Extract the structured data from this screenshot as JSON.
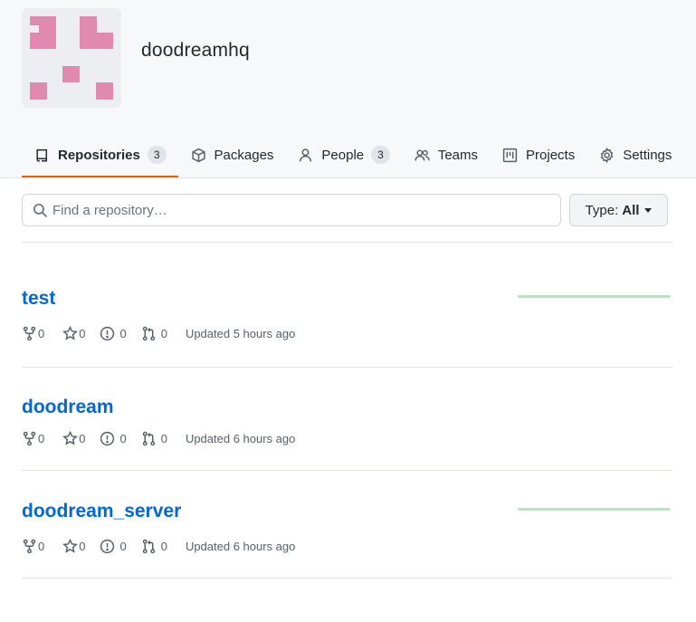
{
  "org": {
    "name": "doodreamhq"
  },
  "nav": {
    "tabs": [
      {
        "label": "Repositories",
        "count": "3",
        "icon": "repo-icon"
      },
      {
        "label": "Packages",
        "icon": "package-icon"
      },
      {
        "label": "People",
        "count": "3",
        "icon": "person-icon"
      },
      {
        "label": "Teams",
        "icon": "people-icon"
      },
      {
        "label": "Projects",
        "icon": "project-icon"
      },
      {
        "label": "Settings",
        "icon": "gear-icon"
      }
    ]
  },
  "search": {
    "placeholder": "Find a repository…",
    "value": ""
  },
  "type_filter": {
    "prefix": "Type:",
    "value": "All"
  },
  "repos": [
    {
      "name": "test",
      "forks": "0",
      "stars": "0",
      "issues": "0",
      "pulls": "0",
      "updated": "Updated 5 hours ago",
      "activity": true
    },
    {
      "name": "doodream",
      "forks": "0",
      "stars": "0",
      "issues": "0",
      "pulls": "0",
      "updated": "Updated 6 hours ago",
      "activity": false
    },
    {
      "name": "doodream_server",
      "forks": "0",
      "stars": "0",
      "issues": "0",
      "pulls": "0",
      "updated": "Updated 6 hours ago",
      "activity": true
    }
  ],
  "colors": {
    "accent_underline": "#e36209",
    "link": "#0366d6",
    "avatar_pink": "#e18aaf",
    "sparkline": "#b6e6c1"
  }
}
